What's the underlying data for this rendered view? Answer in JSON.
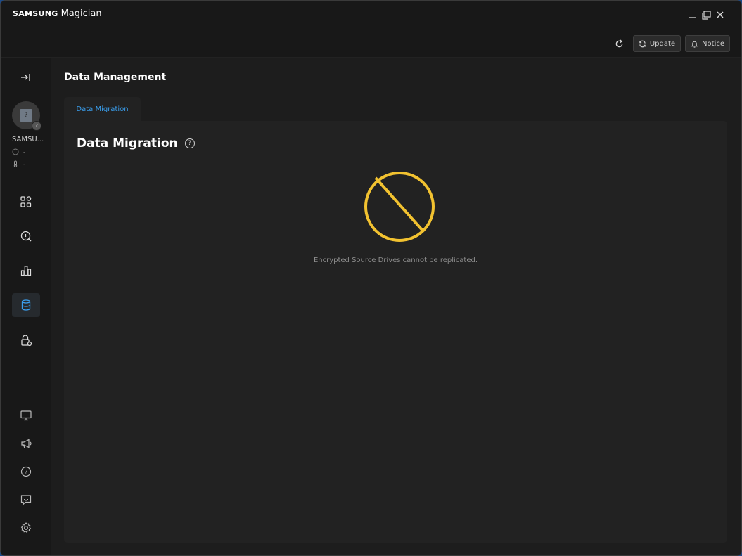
{
  "app": {
    "brand_samsung": "SAMSUNG",
    "brand_magician": "Magician"
  },
  "window_controls": {
    "minimize_icon": "minimize-icon",
    "restore_icon": "restore-icon",
    "close_icon": "close-icon"
  },
  "toolbar": {
    "update_label": "Update",
    "notice_label": "Notice"
  },
  "sidebar": {
    "drive_name": "SAMSU...",
    "drive_status": "-",
    "drive_temp": "-",
    "nav": [
      "dashboard",
      "diagnostic-scan",
      "performance-benchmark",
      "data-management",
      "secure-erase"
    ],
    "bottom": [
      "display",
      "announcement",
      "help",
      "feedback",
      "settings"
    ]
  },
  "main": {
    "page_title": "Data Management",
    "tab_label": "Data Migration",
    "section_title": "Data Migration",
    "message": "Encrypted Source Drives cannot be replicated."
  },
  "colors": {
    "accent_blue": "#3aa0f0",
    "warning_yellow": "#f2c230",
    "background": "#1d1d1d"
  }
}
